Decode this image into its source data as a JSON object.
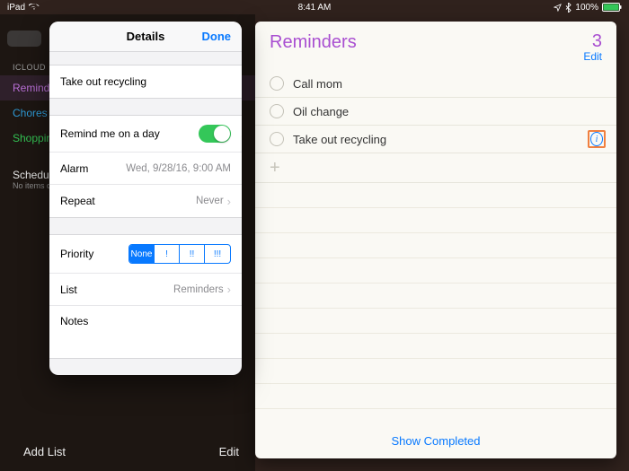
{
  "status": {
    "device": "iPad",
    "time": "8:41 AM",
    "battery_pct": "100%"
  },
  "sidebar": {
    "section": "ICLOUD",
    "lists": [
      {
        "label": "Reminders"
      },
      {
        "label": "Chores"
      },
      {
        "label": "Shopping"
      }
    ],
    "scheduled_title": "Scheduled",
    "scheduled_sub": "No items due.",
    "add_list": "Add List",
    "edit": "Edit"
  },
  "main": {
    "title": "Reminders",
    "count": "3",
    "edit": "Edit",
    "items": [
      {
        "text": "Call mom"
      },
      {
        "text": "Oil change"
      },
      {
        "text": "Take out recycling"
      }
    ],
    "show_completed": "Show Completed"
  },
  "details": {
    "header": "Details",
    "done": "Done",
    "title": "Take out recycling",
    "remind_on_day": "Remind me on a day",
    "alarm_label": "Alarm",
    "alarm_value": "Wed, 9/28/16, 9:00 AM",
    "repeat_label": "Repeat",
    "repeat_value": "Never",
    "priority_label": "Priority",
    "priority_options": [
      "None",
      "!",
      "!!",
      "!!!"
    ],
    "list_label": "List",
    "list_value": "Reminders",
    "notes_label": "Notes"
  }
}
